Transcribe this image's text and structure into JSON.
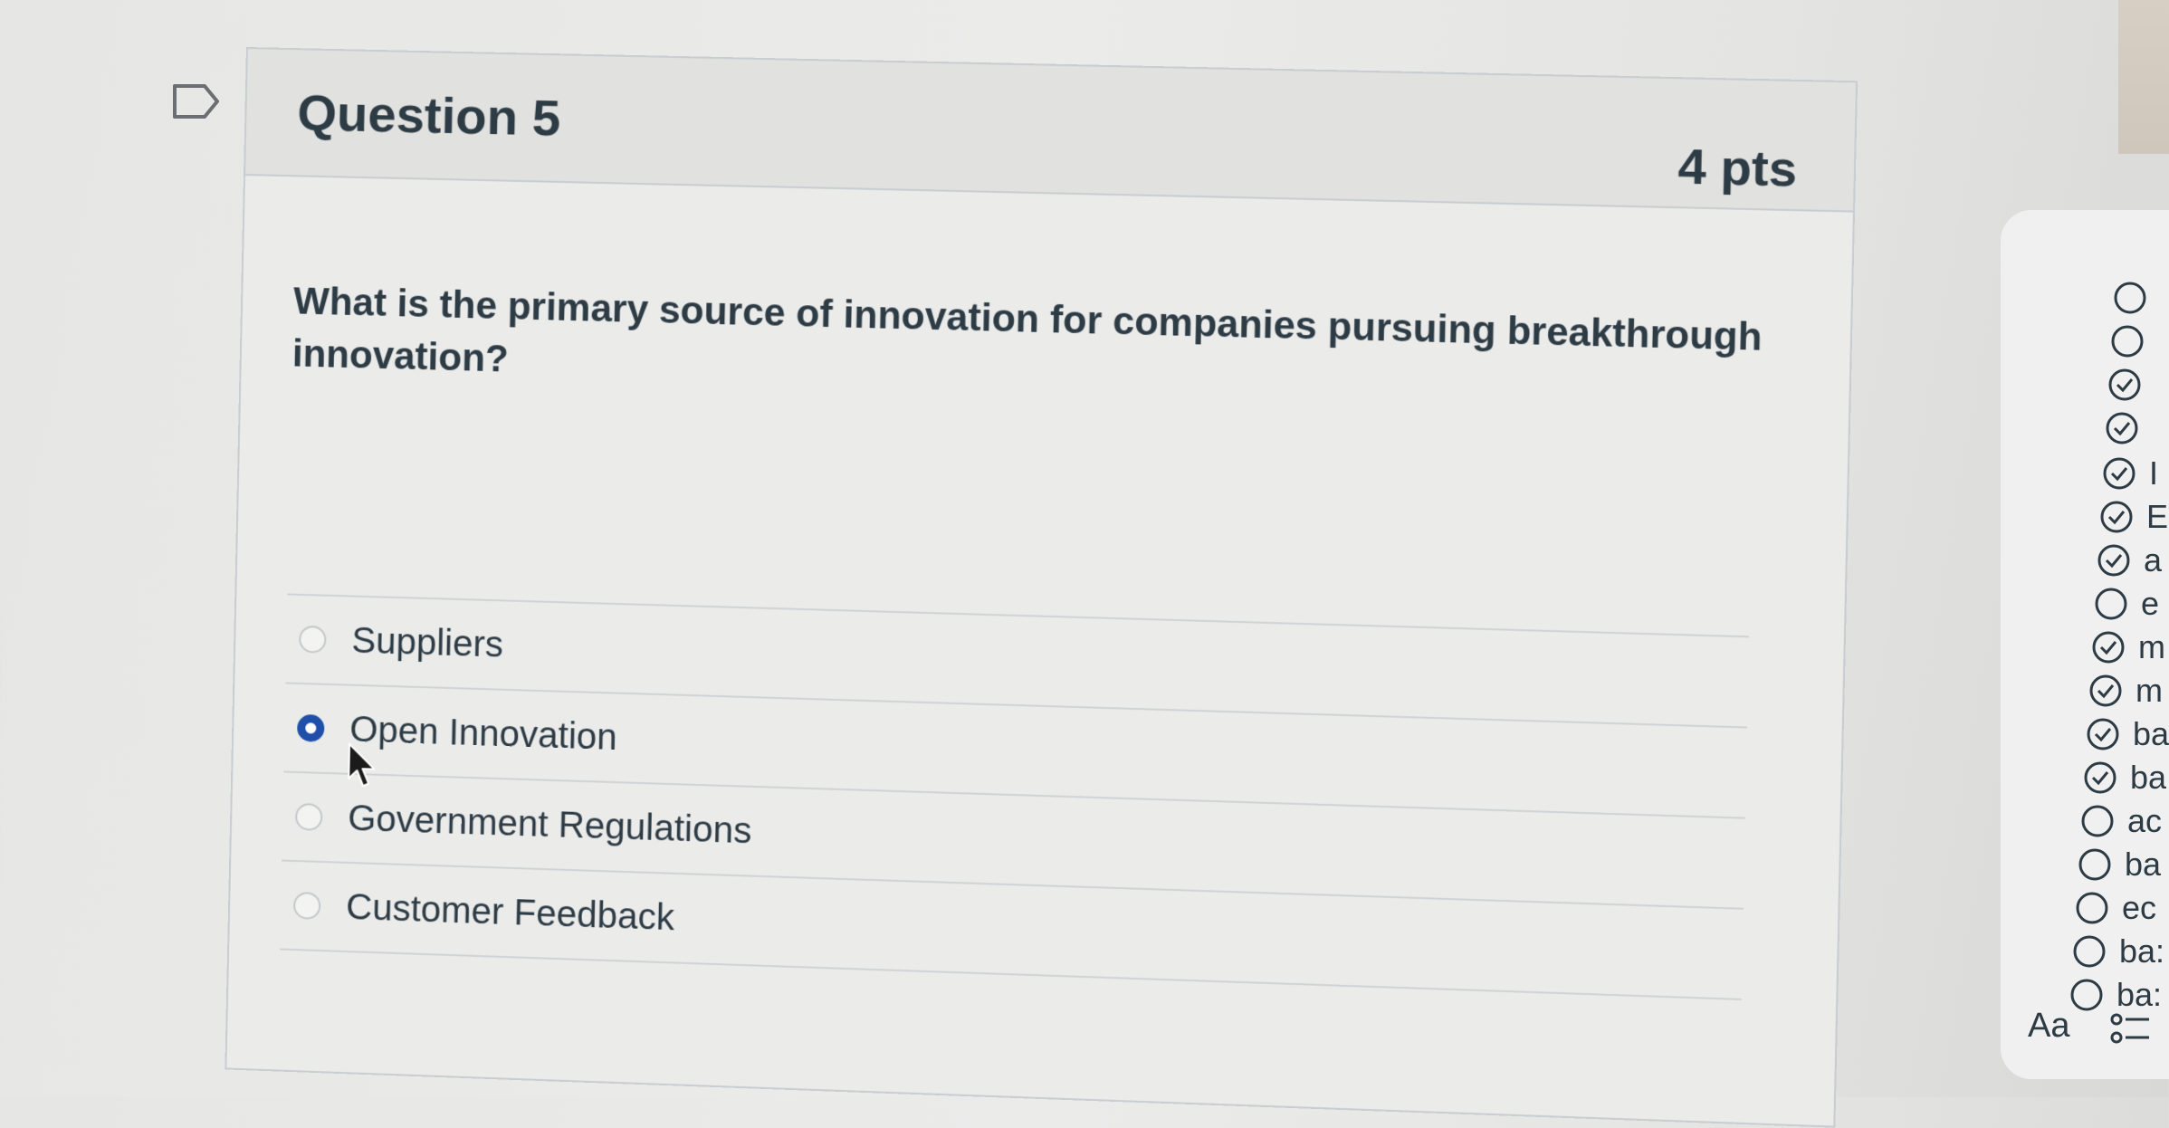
{
  "question": {
    "title": "Question 5",
    "points": "4 pts",
    "text": "What is the primary source of innovation for companies pursuing breakthrough innovation?",
    "answers": [
      {
        "label": "Suppliers",
        "selected": false
      },
      {
        "label": "Open Innovation",
        "selected": true
      },
      {
        "label": "Government Regulations",
        "selected": false
      },
      {
        "label": "Customer Feedback",
        "selected": false
      }
    ]
  },
  "sidebar": {
    "items": [
      {
        "status": "unanswered",
        "label": ""
      },
      {
        "status": "unanswered",
        "label": ""
      },
      {
        "status": "answered",
        "label": ""
      },
      {
        "status": "answered",
        "label": ""
      },
      {
        "status": "answered",
        "label": "I"
      },
      {
        "status": "answered",
        "label": "E"
      },
      {
        "status": "answered",
        "label": "a"
      },
      {
        "status": "unanswered",
        "label": "e"
      },
      {
        "status": "answered",
        "label": "m"
      },
      {
        "status": "answered",
        "label": "m"
      },
      {
        "status": "answered",
        "label": "ba"
      },
      {
        "status": "answered",
        "label": "ba"
      },
      {
        "status": "unanswered",
        "label": "ac"
      },
      {
        "status": "unanswered",
        "label": "ba"
      },
      {
        "status": "unanswered",
        "label": "ec"
      },
      {
        "status": "unanswered",
        "label": "ba:"
      },
      {
        "status": "unanswered",
        "label": "ba:"
      }
    ],
    "footer_text": "Aa"
  },
  "colors": {
    "selected_radio": "#1f4fa8",
    "text": "#2d3b45"
  }
}
